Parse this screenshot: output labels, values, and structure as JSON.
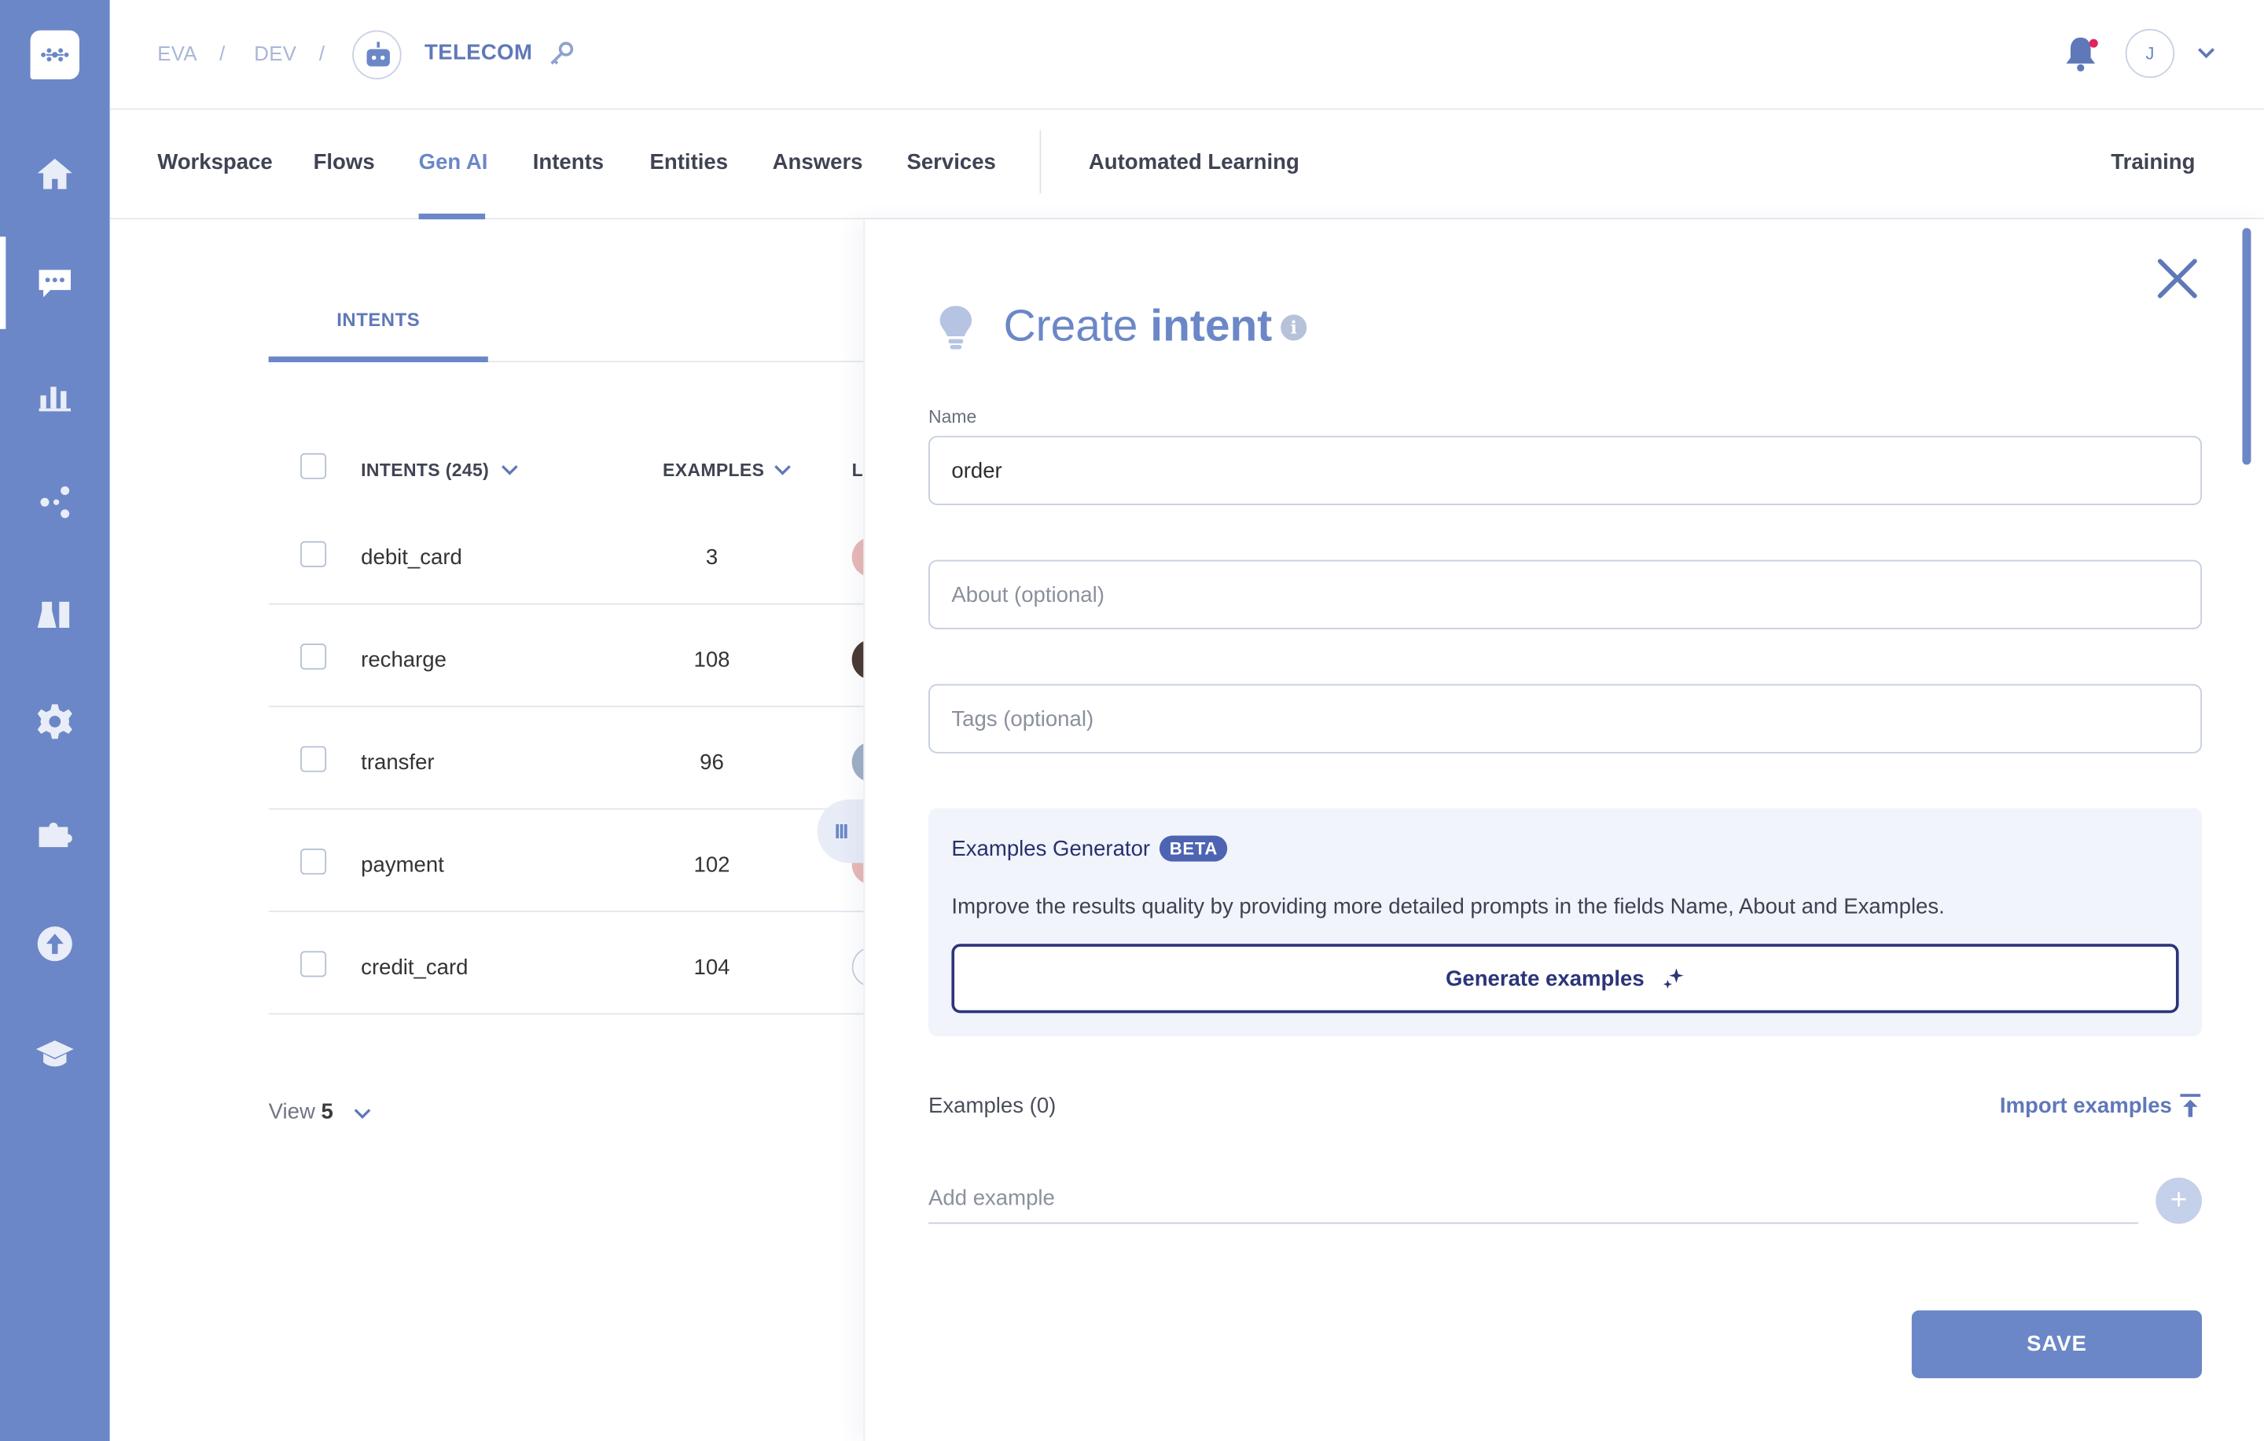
{
  "breadcrumb": {
    "items": [
      "EVA",
      "DEV",
      "TELECOM"
    ],
    "separator": "/"
  },
  "user": {
    "initial": "J"
  },
  "nav": {
    "tabs": [
      "Workspace",
      "Flows",
      "Gen AI",
      "Intents",
      "Entities",
      "Answers",
      "Services",
      "Automated Learning"
    ],
    "active": "Gen AI",
    "right_tab": "Training"
  },
  "list": {
    "tab_label": "INTENTS",
    "columns": {
      "intents": "INTENTS (245)",
      "examples": "EXAMPLES",
      "truncated": "LA"
    },
    "rows": [
      {
        "name": "debit_card",
        "examples": "3"
      },
      {
        "name": "recharge",
        "examples": "108"
      },
      {
        "name": "transfer",
        "examples": "96"
      },
      {
        "name": "payment",
        "examples": "102"
      },
      {
        "name": "credit_card",
        "examples": "104"
      }
    ],
    "view_label": "View",
    "view_value": "5",
    "drag_handle": "III"
  },
  "drawer": {
    "title_light": "Create",
    "title_bold": "intent",
    "info_icon": "i",
    "name_label": "Name",
    "name_value": "order",
    "about_placeholder": "About (optional)",
    "tags_placeholder": "Tags (optional)",
    "generator": {
      "title": "Examples Generator",
      "badge": "BETA",
      "description": "Improve the results quality by providing more detailed prompts in the fields Name, About and Examples.",
      "button": "Generate examples"
    },
    "examples_label": "Examples (0)",
    "import_label": "Import examples",
    "add_example_placeholder": "Add example",
    "add_button": "+",
    "save_label": "SAVE"
  },
  "colors": {
    "sidebar": "#6b87c7",
    "accent": "#6b87c7",
    "generator_bg": "#f1f4fb",
    "generator_accent": "#2c347a"
  },
  "icons": {
    "sidebar": [
      "home-icon",
      "chat-icon",
      "chart-icon",
      "share-icon",
      "lab-icon",
      "gear-icon",
      "puzzle-icon",
      "upload-icon",
      "graduation-icon"
    ]
  }
}
